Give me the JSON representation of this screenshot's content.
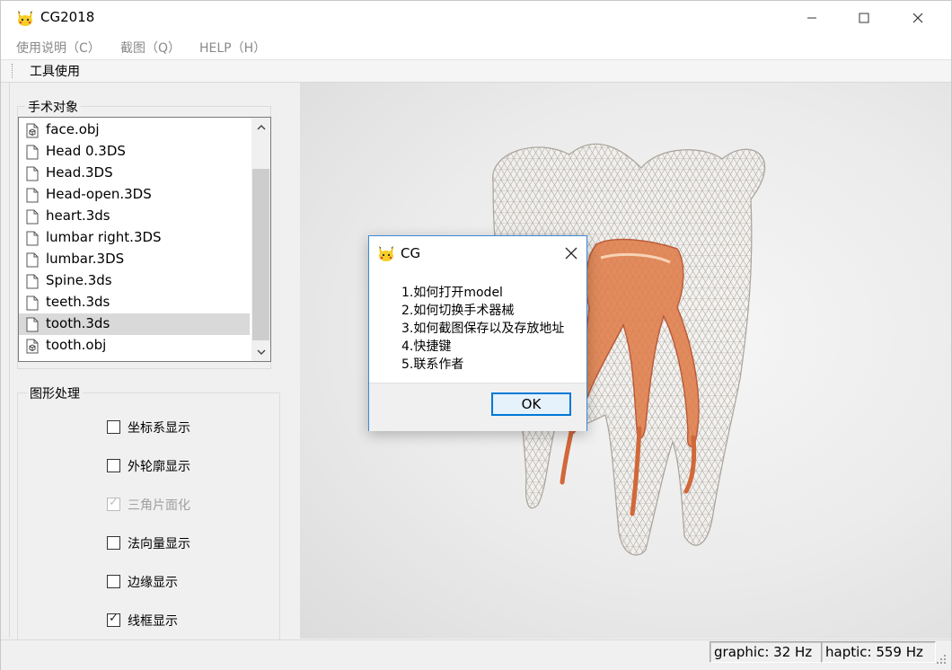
{
  "window": {
    "title": "CG2018"
  },
  "menu": [
    {
      "label": "使用说明（C）"
    },
    {
      "label": "截图（Q）"
    },
    {
      "label": "HELP（H）"
    }
  ],
  "toolbar": {
    "label": "工具使用"
  },
  "surgery_group": {
    "title": "手术对象",
    "files": [
      {
        "name": "face.obj",
        "icon": "obj-file-icon"
      },
      {
        "name": "Head 0.3DS",
        "icon": "file-icon"
      },
      {
        "name": "Head.3DS",
        "icon": "file-icon"
      },
      {
        "name": "Head-open.3DS",
        "icon": "file-icon"
      },
      {
        "name": "heart.3ds",
        "icon": "file-icon"
      },
      {
        "name": "lumbar right.3DS",
        "icon": "file-icon"
      },
      {
        "name": "lumbar.3DS",
        "icon": "file-icon"
      },
      {
        "name": "Spine.3ds",
        "icon": "file-icon"
      },
      {
        "name": "teeth.3ds",
        "icon": "file-icon"
      },
      {
        "name": "tooth.3ds",
        "icon": "file-icon",
        "selected": true
      },
      {
        "name": "tooth.obj",
        "icon": "obj-file-icon"
      }
    ]
  },
  "graphics_group": {
    "title": "图形处理",
    "options": [
      {
        "label": "坐标系显示",
        "checked": false,
        "disabled": false
      },
      {
        "label": "外轮廓显示",
        "checked": false,
        "disabled": false
      },
      {
        "label": "三角片面化",
        "checked": true,
        "disabled": true
      },
      {
        "label": "法向量显示",
        "checked": false,
        "disabled": false
      },
      {
        "label": "边缘显示",
        "checked": false,
        "disabled": false
      },
      {
        "label": "线框显示",
        "checked": true,
        "disabled": false
      }
    ]
  },
  "status": {
    "graphic": "graphic:  32 Hz",
    "haptic": "haptic:  559 Hz"
  },
  "dialog": {
    "title": "CG",
    "items": [
      "1.如何打开model",
      "2.如何切换手术器械",
      "3.如何截图保存以及存放地址",
      "4.快捷键",
      "5.联系作者"
    ],
    "ok_label": "OK"
  },
  "colors": {
    "accent": "#0078d7",
    "selection": "#d9d9d9",
    "tooth_wire": "#c9c4bc",
    "pulp": "#d9602c"
  }
}
